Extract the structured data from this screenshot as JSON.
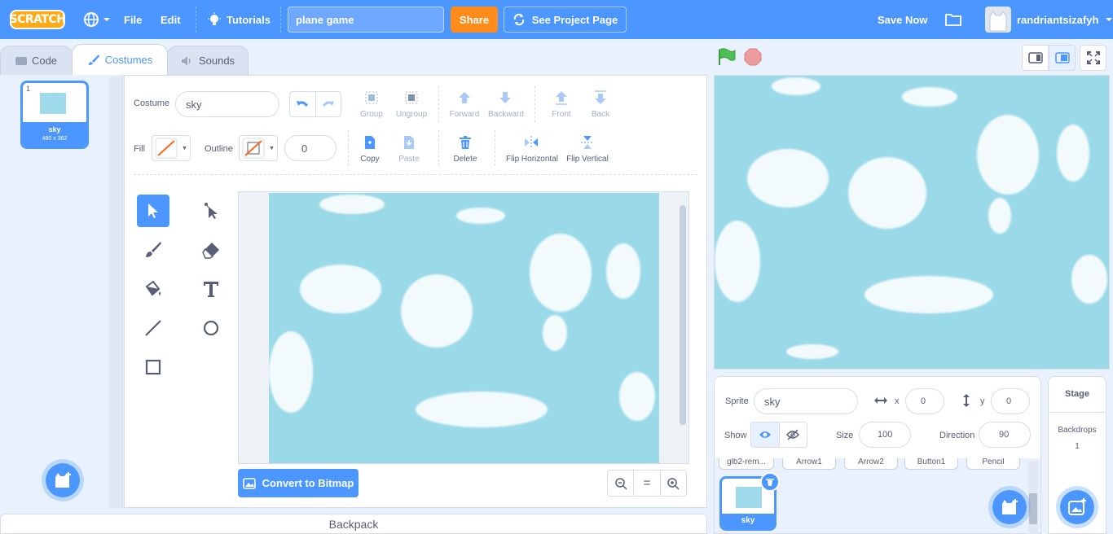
{
  "menu": {
    "logo": "SCRATCH",
    "file": "File",
    "edit": "Edit",
    "tutorials": "Tutorials",
    "project_title": "plane game",
    "share": "Share",
    "see_project": "See Project Page",
    "save_now": "Save Now",
    "username": "randriantsizafyh"
  },
  "tabs": {
    "code": "Code",
    "costumes": "Costumes",
    "sounds": "Sounds"
  },
  "costume_list": [
    {
      "number": "1",
      "name": "sky",
      "size": "480 x 362"
    }
  ],
  "paint": {
    "costume_label": "Costume",
    "costume_name": "sky",
    "fill_label": "Fill",
    "outline_label": "Outline",
    "outline_width": "0",
    "group": "Group",
    "ungroup": "Ungroup",
    "forward": "Forward",
    "backward": "Backward",
    "front": "Front",
    "back": "Back",
    "copy": "Copy",
    "paste": "Paste",
    "delete": "Delete",
    "flip_horizontal": "Flip Horizontal",
    "flip_vertical": "Flip Vertical",
    "convert": "Convert to Bitmap",
    "zoom_reset": "="
  },
  "backpack": "Backpack",
  "sprite_info": {
    "sprite_label": "Sprite",
    "sprite_name": "sky",
    "x_label": "x",
    "x": "0",
    "y_label": "y",
    "y": "0",
    "show_label": "Show",
    "size_label": "Size",
    "size": "100",
    "direction_label": "Direction",
    "direction": "90"
  },
  "sprite_tiles_above": [
    "glb2-rem...",
    "Arrow1",
    "Arrow2",
    "Button1",
    "Pencil"
  ],
  "selected_sprite": "sky",
  "stage_panel": {
    "title": "Stage",
    "backdrops_label": "Backdrops",
    "backdrops_count": "1"
  },
  "colors": {
    "accent": "#4c97ff",
    "share": "#ff8c1a",
    "sky": "#9ad9e8"
  }
}
